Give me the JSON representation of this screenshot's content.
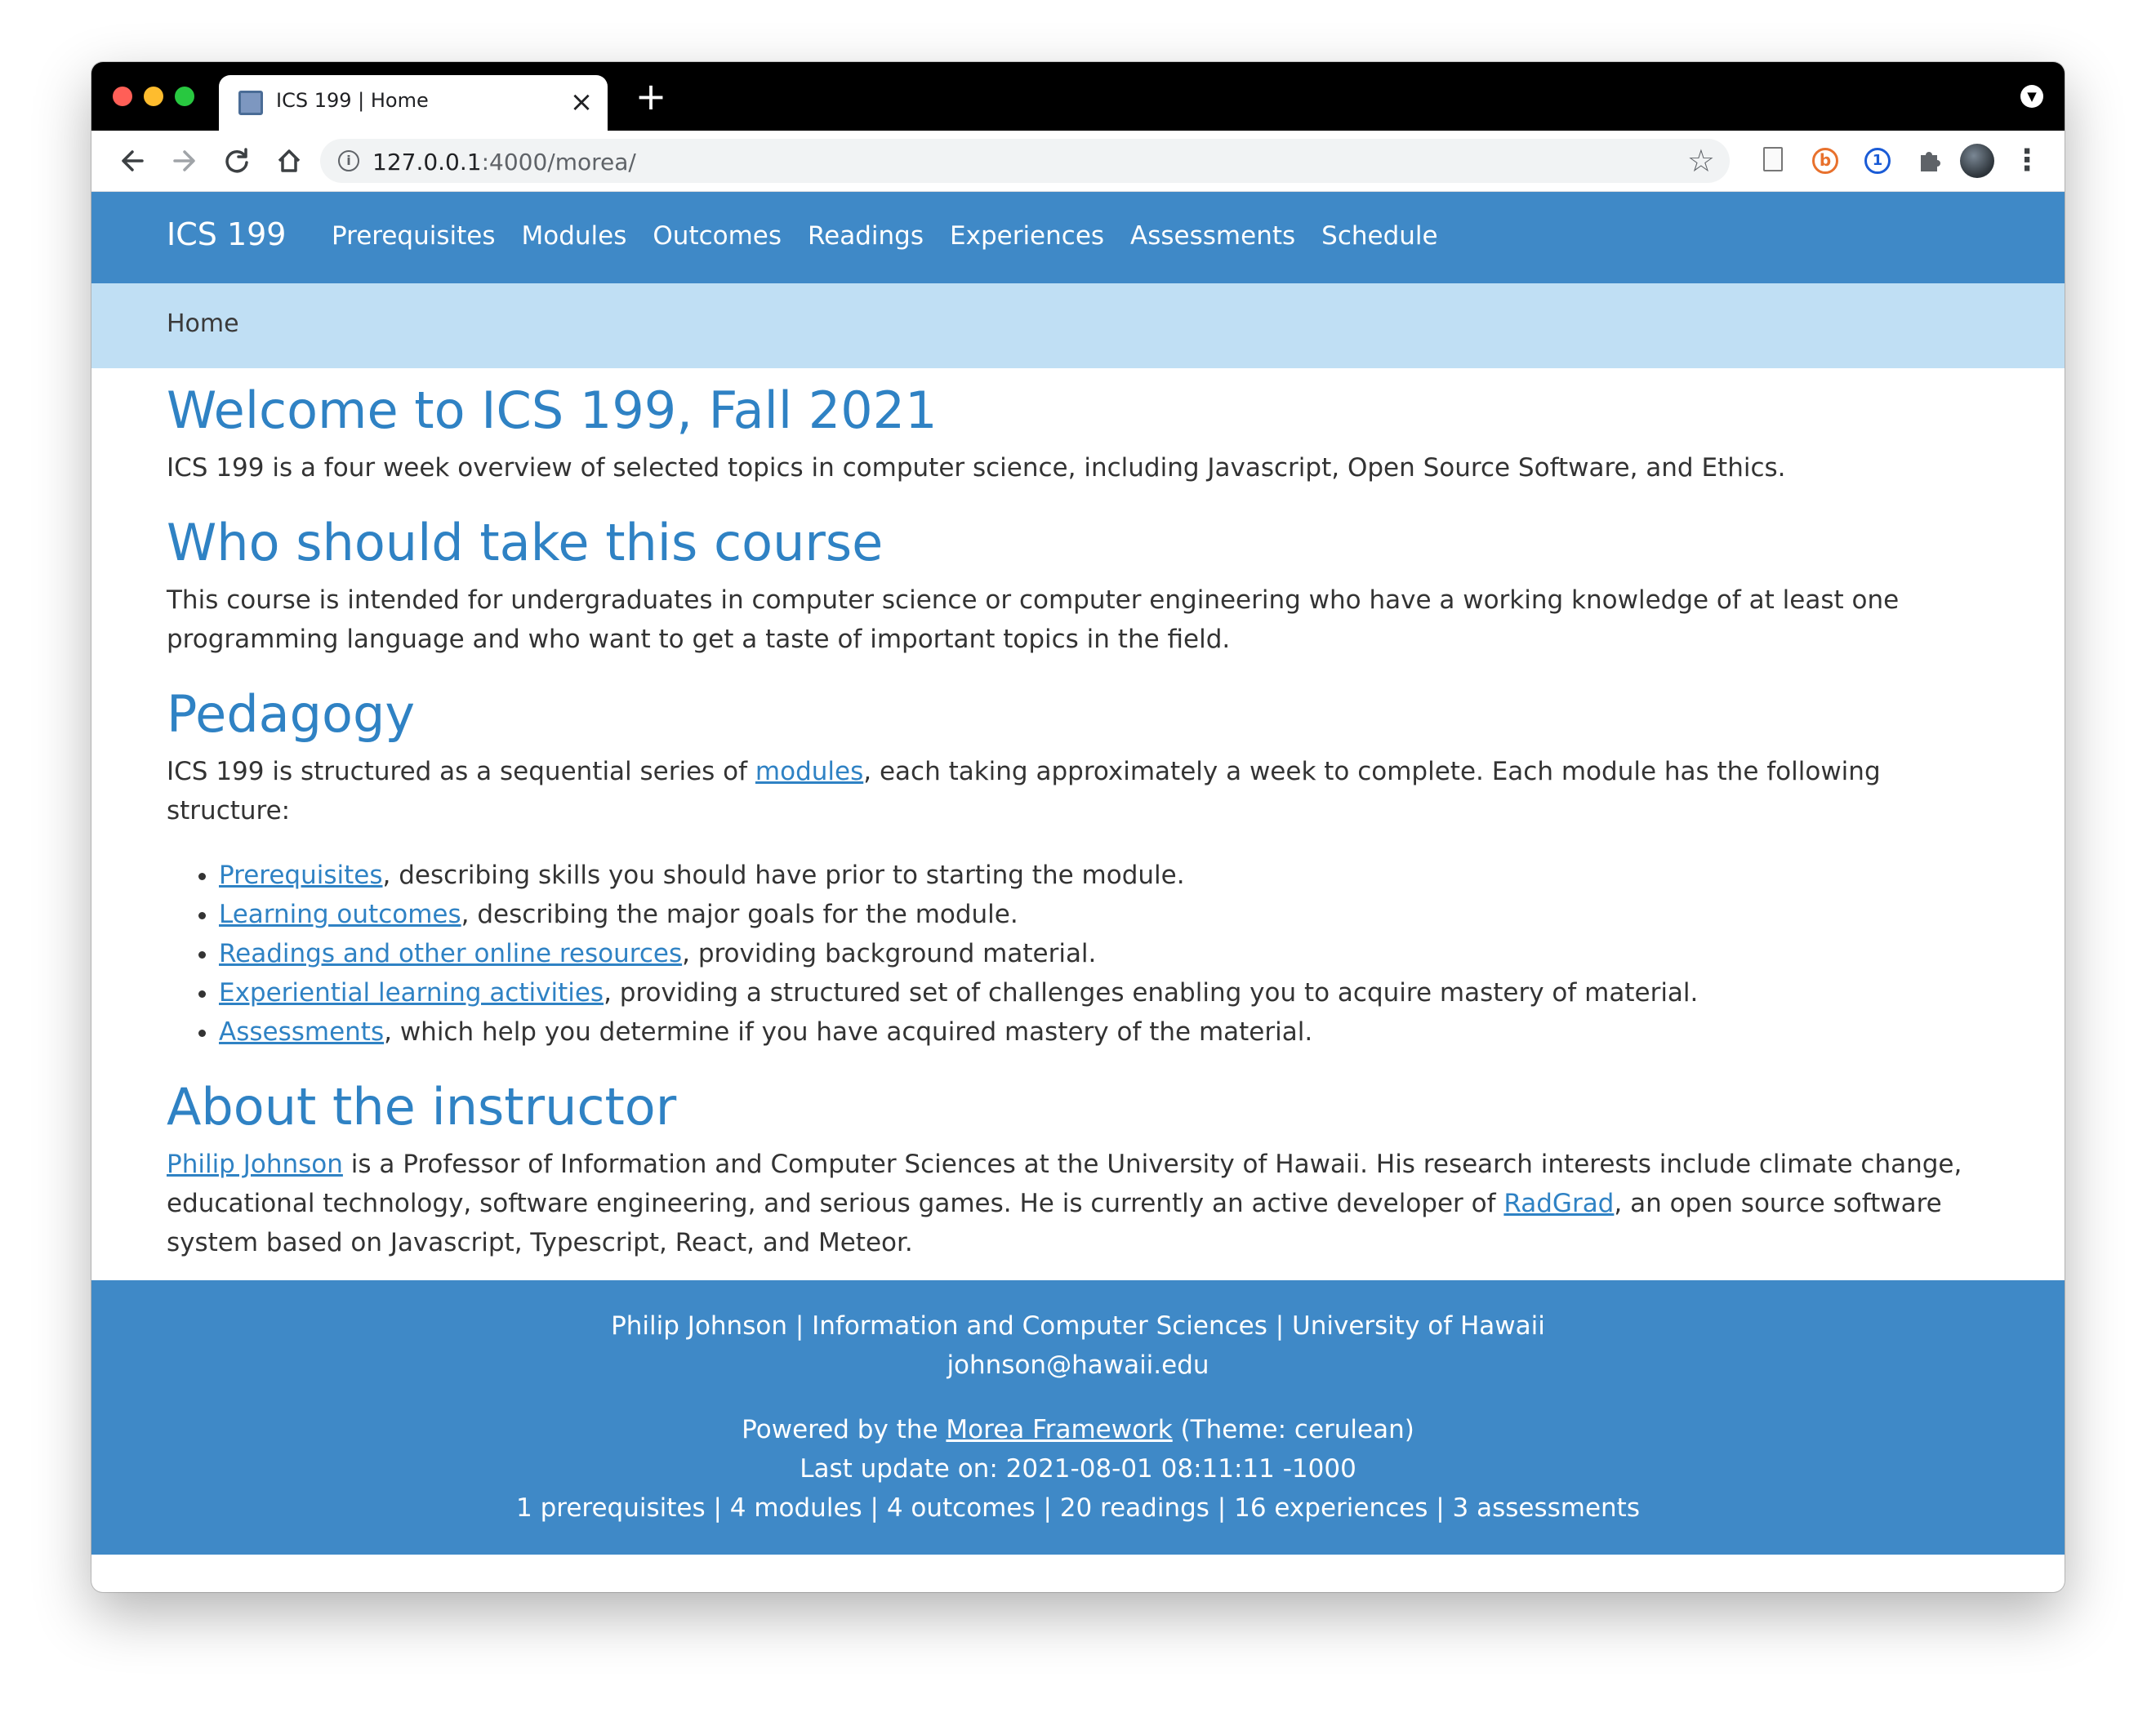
{
  "browser": {
    "tab_title": "ICS 199 | Home",
    "tab_close": "×",
    "new_tab": "+",
    "url_host": "127.0.0.1",
    "url_rest": ":4000/morea/",
    "icons": [
      "back-icon",
      "forward-icon",
      "reload-icon",
      "home-icon",
      "info-icon",
      "star-icon",
      "puzzle-icon",
      "menu-icon"
    ]
  },
  "navbar": {
    "brand": "ICS 199",
    "links": [
      "Prerequisites",
      "Modules",
      "Outcomes",
      "Readings",
      "Experiences",
      "Assessments",
      "Schedule"
    ]
  },
  "breadcrumb": "Home",
  "welcome": {
    "title": "Welcome to ICS 199, Fall 2021",
    "text": "ICS 199 is a four week overview of selected topics in computer science, including Javascript, Open Source Software, and Ethics."
  },
  "audience": {
    "title": "Who should take this course",
    "text": "This course is intended for undergraduates in computer science or computer engineering who have a working knowledge of at least one programming language and who want to get a taste of important topics in the field."
  },
  "pedagogy": {
    "title": "Pedagogy",
    "intro_before": "ICS 199 is structured as a sequential series of ",
    "intro_link": "modules",
    "intro_after": ", each taking approximately a week to complete. Each module has the following structure:",
    "items": [
      {
        "link": "Prerequisites",
        "text": ", describing skills you should have prior to starting the module."
      },
      {
        "link": "Learning outcomes",
        "text": ", describing the major goals for the module."
      },
      {
        "link": "Readings and other online resources",
        "text": ", providing background material."
      },
      {
        "link": "Experiential learning activities",
        "text": ", providing a structured set of challenges enabling you to acquire mastery of material."
      },
      {
        "link": "Assessments",
        "text": ", which help you determine if you have acquired mastery of the material."
      }
    ]
  },
  "instructor": {
    "title": "About the instructor",
    "name_link": "Philip Johnson",
    "text1": " is a Professor of Information and Computer Sciences at the University of Hawaii. His research interests include climate change, educational technology, software engineering, and serious games. He is currently an active developer of ",
    "radgrad_link": "RadGrad",
    "text2": ", an open source software system based on Javascript, Typescript, React, and Meteor."
  },
  "footer": {
    "line1": "Philip Johnson | Information and Computer Sciences | University of Hawaii",
    "email": "johnson@hawaii.edu",
    "powered_before": "Powered by the ",
    "powered_link": "Morea Framework",
    "powered_after": " (Theme: cerulean)",
    "last_update": "Last update on: 2021-08-01 08:11:11 -1000",
    "stats": "1 prerequisites | 4 modules | 4 outcomes | 20 readings | 16 experiences | 3 assessments"
  },
  "colors": {
    "primary": "#3f89c7",
    "breadcrumb_bg": "#c0dff4",
    "heading": "#2f82c4",
    "body_text": "#333333"
  }
}
